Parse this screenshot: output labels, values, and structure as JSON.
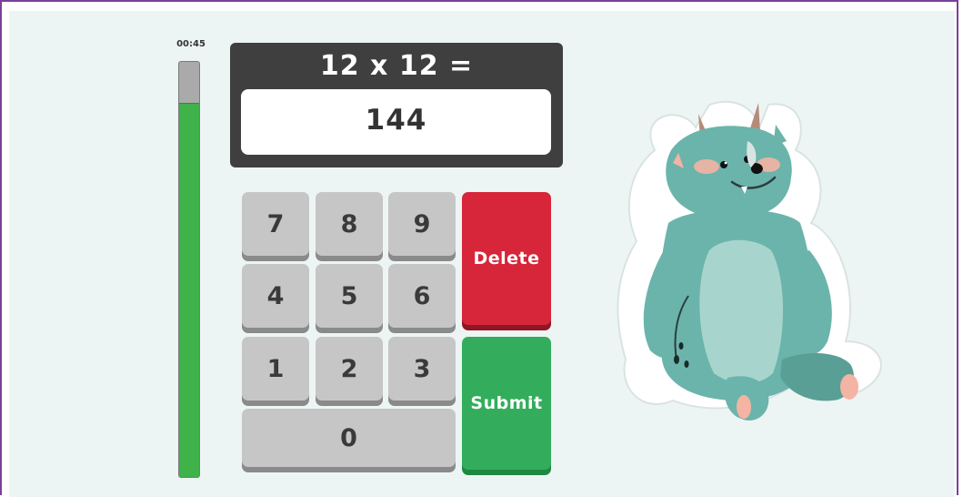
{
  "timer": {
    "time_text": "00:45",
    "remaining_fraction": 0.9
  },
  "question": {
    "text": "12 x 12 ="
  },
  "answer": {
    "value": "144"
  },
  "keypad": {
    "keys": [
      "7",
      "8",
      "9",
      "4",
      "5",
      "6",
      "1",
      "2",
      "3",
      "0"
    ],
    "delete_label": "Delete",
    "submit_label": "Submit"
  },
  "colors": {
    "timer_fill": "#3fb24a",
    "delete": "#d7253a",
    "submit": "#33ad5c",
    "panel": "#3f3f3f",
    "frame": "#7b3f98"
  },
  "mascot": {
    "icon": "monster-mascot-icon"
  }
}
